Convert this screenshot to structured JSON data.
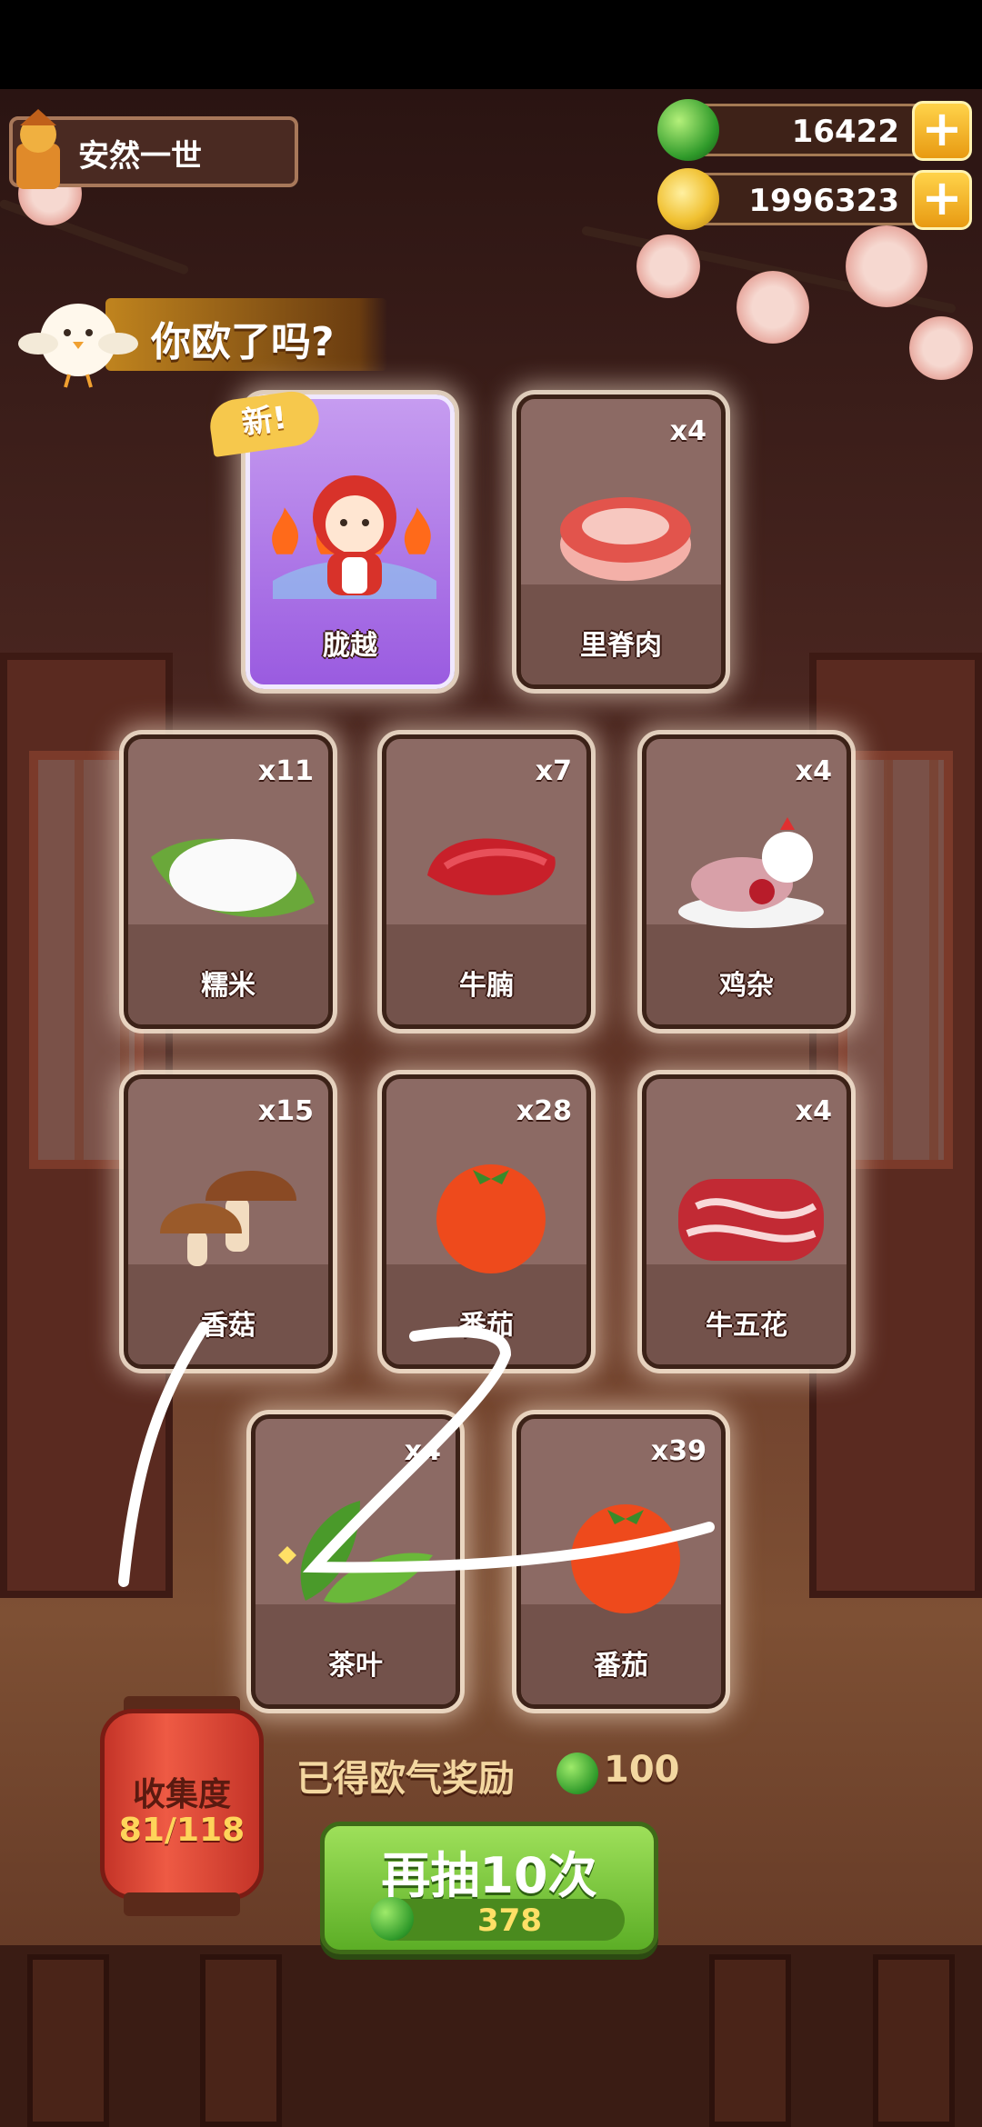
{
  "player": {
    "name": "安然一世"
  },
  "currencies": {
    "jade": {
      "value": "16422",
      "icon": "jade-coin-icon"
    },
    "gold": {
      "value": "1996323",
      "icon": "gold-coin-icon"
    }
  },
  "banner": {
    "text": "你欧了吗?"
  },
  "cards": [
    {
      "label": "胧越",
      "count": "",
      "rare": true,
      "new_tag": "新!",
      "flames": 4
    },
    {
      "label": "里脊肉",
      "count": "x4"
    },
    {
      "label": "糯米",
      "count": "x11"
    },
    {
      "label": "牛腩",
      "count": "x7"
    },
    {
      "label": "鸡杂",
      "count": "x4"
    },
    {
      "label": "香菇",
      "count": "x15"
    },
    {
      "label": "番茄",
      "count": "x28"
    },
    {
      "label": "牛五花",
      "count": "x4"
    },
    {
      "label": "茶叶",
      "count": "x4"
    },
    {
      "label": "番茄",
      "count": "x39"
    }
  ],
  "collection": {
    "title": "收集度",
    "progress": "81/118"
  },
  "reward": {
    "label": "已得欧气奖励",
    "value": "100"
  },
  "draw_button": {
    "label": "再抽10次",
    "cost": "378"
  },
  "colors": {
    "accent": "#6cc030",
    "gold": "#f6c84c",
    "rare": "#b070f0"
  }
}
